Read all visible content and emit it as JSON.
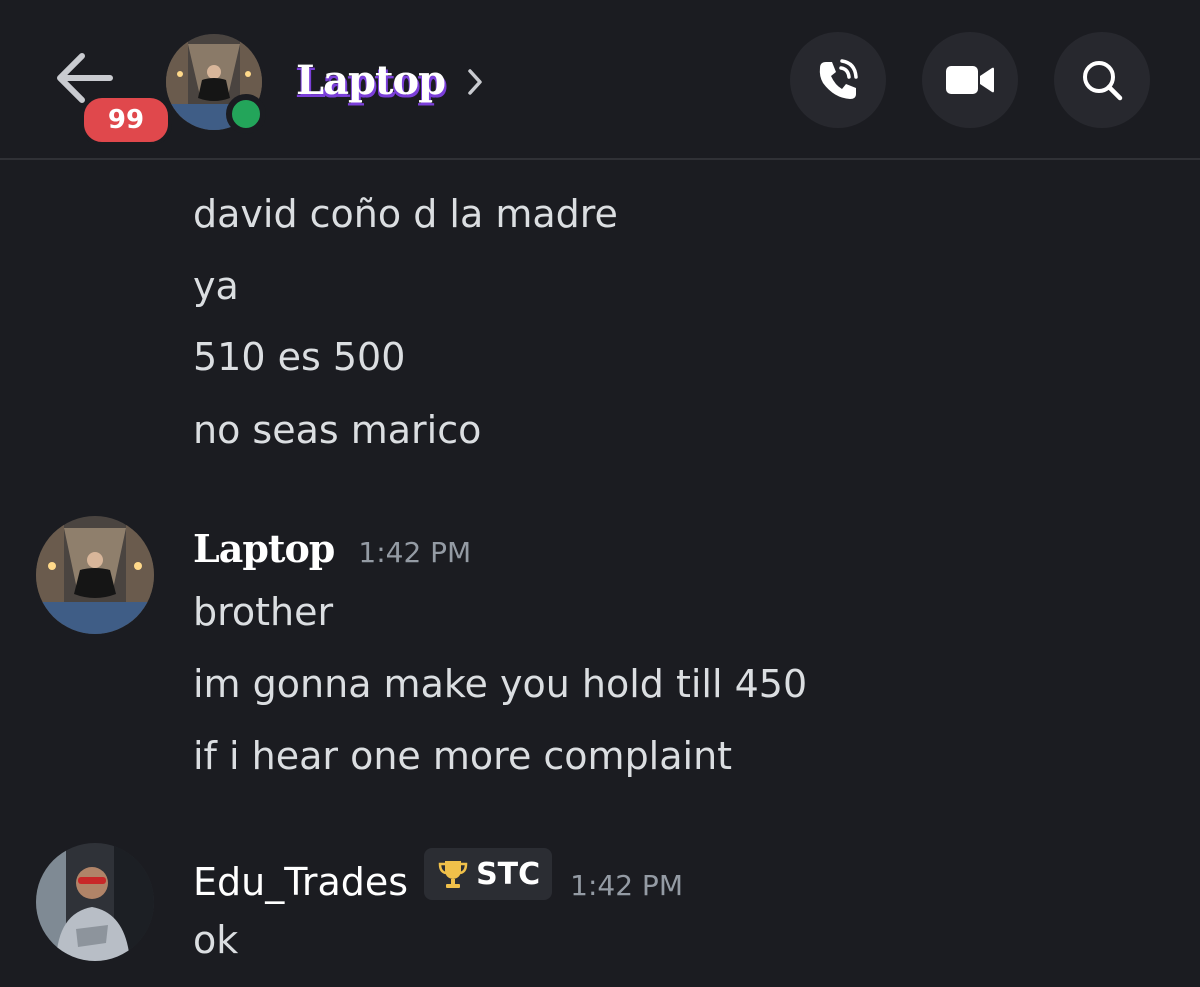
{
  "header": {
    "unread_count": "99",
    "channel_name": "Laptop",
    "status": "online",
    "colors": {
      "badge": "#e0484c",
      "online": "#23a55a",
      "name_shadow": "#7b3fd9"
    }
  },
  "actions": {
    "call_icon": "phone-icon",
    "video_icon": "video-camera-icon",
    "search_icon": "search-icon"
  },
  "messages": {
    "continued": [
      "david coño d la madre",
      "ya",
      "510 es 500",
      "no seas marico"
    ],
    "laptop_group": {
      "author": "Laptop",
      "timestamp": "1:42 PM",
      "lines": [
        "brother",
        "im gonna make you hold till 450",
        "if i hear one more complaint"
      ]
    },
    "edu_group": {
      "author": "Edu_Trades",
      "tag": "STC",
      "tag_icon": "trophy-icon",
      "timestamp": "1:42 PM",
      "lines": [
        "ok"
      ]
    }
  }
}
